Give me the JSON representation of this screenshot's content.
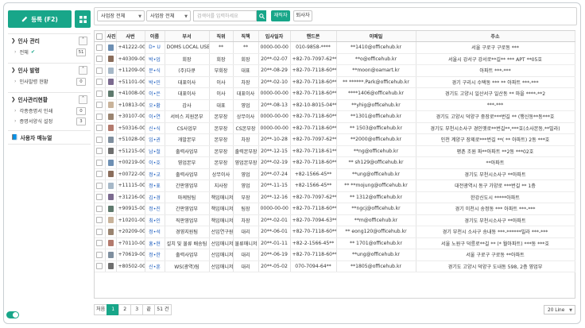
{
  "sidebar": {
    "register_label": "등록 (F2)",
    "groups": [
      {
        "title": "인사 관리",
        "items": [
          {
            "label": "전체",
            "count": "51",
            "checked": true
          }
        ]
      },
      {
        "title": "인사 발령",
        "items": [
          {
            "label": "인사발령 현황",
            "count": "0"
          }
        ]
      },
      {
        "title": "인사관리현황",
        "items": [
          {
            "label": "각종증명서 인쇄",
            "count": "0"
          },
          {
            "label": "증명서양식 설정",
            "count": "3"
          }
        ]
      }
    ],
    "manual_label": "사용자 매뉴얼"
  },
  "filter": {
    "select1": "사업장 전체",
    "select2": "사업장 전체",
    "search_placeholder": "검색어를 입력하세요",
    "btn_employed": "재직자",
    "btn_resigned": "퇴사자"
  },
  "table": {
    "columns": [
      "",
      "사진",
      "사번",
      "이름",
      "부서",
      "직위",
      "직책",
      "입사일자",
      "핸드폰",
      "이메일",
      "주소"
    ],
    "rows": [
      [
        "",
        "+41222-0002",
        "D• U",
        "DOMS LOCAL USER",
        "**",
        "**",
        "0000-00-00",
        "010-9858-****",
        "**1410@officehub.kr",
        "서울 구로구 구로동 ***"
      ],
      [
        "",
        "+40309-0001",
        "박•업",
        "회장",
        "회장",
        "회장",
        "20**-02-07",
        "+82-70-7097-62**",
        "**o@officehub.kr",
        "서울시 강서구 강서로**길** *** APT **05호"
      ],
      [
        "",
        "+11209-0001",
        "문•식",
        "(주)다큐",
        "부회장",
        "대표",
        "20**-08-29",
        "+82-70-7118-60**",
        "**moon@oamart.kr",
        "아파트 ***-***"
      ],
      [
        "",
        "+51101-0001",
        "박•민",
        "대표이사",
        "이사",
        "차장",
        "20**-02-10",
        "+82-70-7118-60**",
        "** ******.Park@officehub.kr",
        "경기 구리시 수택동 *** ** 아파트 ***-***"
      ],
      [
        "",
        "+41008-0001",
        "이•은",
        "대표이사",
        "이사",
        "대표이사",
        "0000-00-00",
        "+82-70-7118-60**",
        "****1406@officehub.kr",
        "경기도 고양시 일산서구 일산동 ** 마을 ****-**2"
      ],
      [
        "",
        "+10813-0001",
        "오•황",
        "감사",
        "대표",
        "영업",
        "20**-08-13",
        "+82-10-8015-04**",
        "**yhig@officehub.kr",
        "***-***"
      ],
      [
        "",
        "+30107-0001",
        "이•연",
        "서비스 지원본부",
        "본부장",
        "상무이사",
        "0000-00-00",
        "+82-70-7118-60**",
        "**1301@officehub.kr",
        "경기도 고양시 덕양구 중장로***번길 ** (행신동**동***호"
      ],
      [
        "",
        "+50316-0001",
        "신•식",
        "CS사업부",
        "본부장",
        "CS본부장",
        "0000-00-00",
        "+82-70-7118-60**",
        "** 1503@officehub.kr",
        "경기도 부천시소사구 경인옛로**번길**,***호(소사본동,**빌라)"
      ],
      [
        "",
        "+51028-0001",
        "임•권",
        "개발본부",
        "본부장",
        "차장",
        "20**-10-28",
        "+82-70-7097-62**",
        "**2000@officehub.kr",
        "인천 계양구 장제로***번길 **( ** 아파트) 2동 ***호"
      ],
      [
        "",
        "+51215-0001",
        "남•철",
        "출력사업부",
        "본부장",
        "출력본부장",
        "20**-12-15",
        "+82-70-7118-61**",
        "**ng@officehub.kr",
        "평촌 조원 파**아파트 **2동 ***02호"
      ],
      [
        "",
        "+00219-0001",
        "이•호",
        "영업본부",
        "본부장",
        "영업본부장",
        "20**-02-19",
        "+82-70-7118-60**",
        "** sh129@officehub.kr",
        "**아파트"
      ],
      [
        "",
        "+00722-0001",
        "정•교",
        "출력사업부",
        "상무이사",
        "영업",
        "20**-07-24",
        "+82-1566-45**",
        "**ung@officehub.kr",
        "경기도 부천시소사구 **아파트"
      ],
      [
        "",
        "+11115-0002",
        "정•표",
        "간판영업부",
        "지사장",
        "영업",
        "20**-11-15",
        "+82-1566-45**",
        "** **mojung@officehub.kr",
        "대전광역시 동구 가양로 ***번길 ** 1층"
      ],
      [
        "",
        "+31216-0001",
        "김•경",
        "마케팅팀",
        "책임매니저",
        "부장",
        "20**-12-16",
        "+82-70-7097-62**",
        "** 1312@officehub.kr",
        "한강신도시 *****아파트"
      ],
      [
        "",
        "+90915-0001",
        "정•진",
        "간판영업부",
        "책임매니저",
        "팀장",
        "0000-00-00",
        "+82-70-7118-60**",
        "**ngcj@officehub.kr",
        "경기 이천시 송정동 *** 아파트 ***-***"
      ],
      [
        "",
        "+10201-0001",
        "최•인",
        "직판영업부",
        "책임매니저",
        "차장",
        "20**-02-01",
        "+82-70-7094-63**",
        "**m@officehub.kr",
        "경기도 부천시소사구 **아파트"
      ],
      [
        "",
        "+20209-0001",
        "정•석",
        "경영지원팀",
        "선임연구원",
        "대리",
        "20**-06-01",
        "+82-70-7118-60**",
        "** eong120@officehub.kr",
        "경기 부천시 소사구 송내동 ***-******빌라 ***-***"
      ],
      [
        "",
        "+70110-0001",
        "홍•현",
        "설치 및 물류 배송팀",
        "선임매니저",
        "물류매니저",
        "20**-01-11",
        "+82-2-1566-45**",
        "** 1701@officehub.kr",
        "서울 노원구 덕릉로**길 ** (* 월아파트) ***동 ***호"
      ],
      [
        "",
        "+70619-0001",
        "정•한",
        "출력사업부",
        "선임매니저",
        "대리",
        "20**-06-19",
        "+82-70-7118-60**",
        "**ung@officehub.kr",
        "서울 구로구 구로동 **아파트"
      ],
      [
        "",
        "+80502-0002",
        "신•훈",
        "WS(광역)팀",
        "선임매니저",
        "대리",
        "20**-05-02",
        "070-7094-64**",
        "**1805@officehub.kr",
        "경기도 고양시 덕양구 도내동 598, 2층 영업부"
      ]
    ]
  },
  "pager": {
    "first": "처음",
    "pages": [
      "1",
      "2",
      "3"
    ],
    "last": "끝",
    "total": "51 건",
    "page_size": "20 Line"
  },
  "colors": {
    "accent": "#18a689",
    "name_link": "#1f5fbf"
  }
}
